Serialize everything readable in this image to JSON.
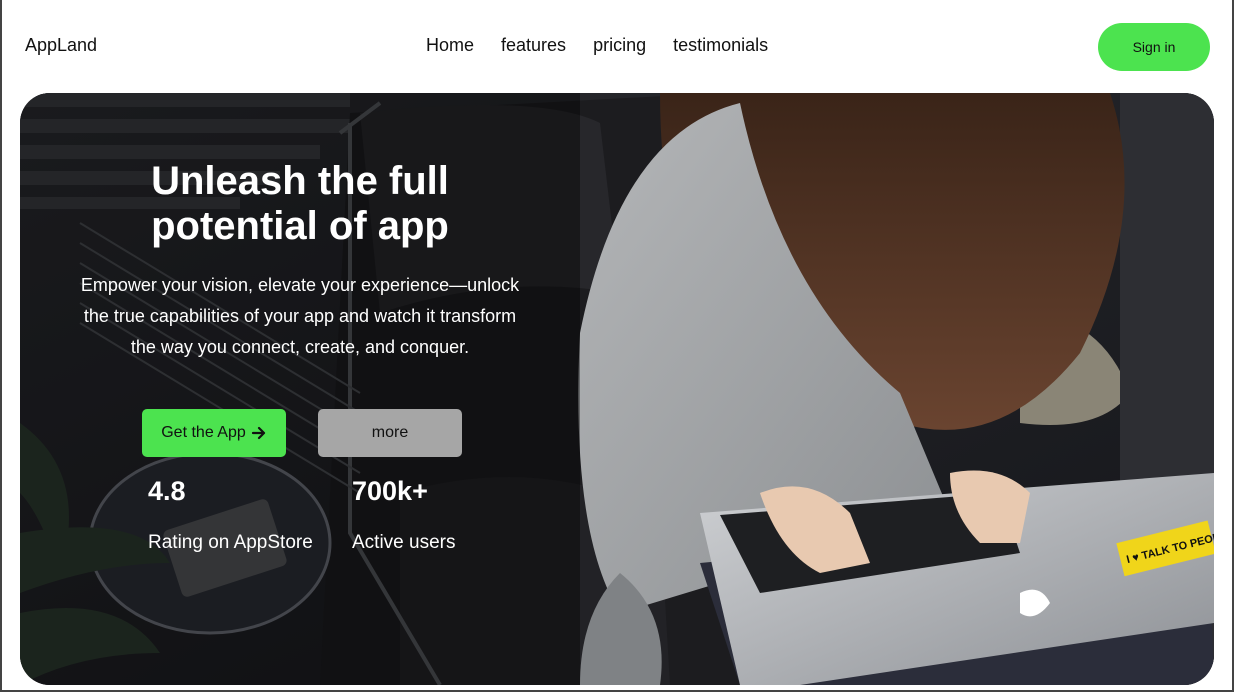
{
  "header": {
    "brand": "AppLand",
    "nav": [
      "Home",
      "features",
      "pricing",
      "testimonials"
    ],
    "signin_label": "Sign in"
  },
  "hero": {
    "headline_line1": "Unleash the full",
    "headline_line2": "potential of app",
    "subtext": "Empower your vision, elevate your experience—unlock the true capabilities of your app and watch it transform the way you connect, create, and conquer.",
    "cta_label": "Get the App",
    "cta_icon": "arrow-right-icon",
    "more_label": "more",
    "stats": [
      {
        "value": "4.8",
        "label": "Rating on AppStore"
      },
      {
        "value": "700k+",
        "label": "Active users"
      }
    ],
    "sticker_text": "I ♥ TALK TO PEOPLE"
  },
  "colors": {
    "accent": "#4ce34f",
    "secondary_button": "#a6a6a6",
    "text_dark": "#111111",
    "text_light": "#ffffff"
  }
}
